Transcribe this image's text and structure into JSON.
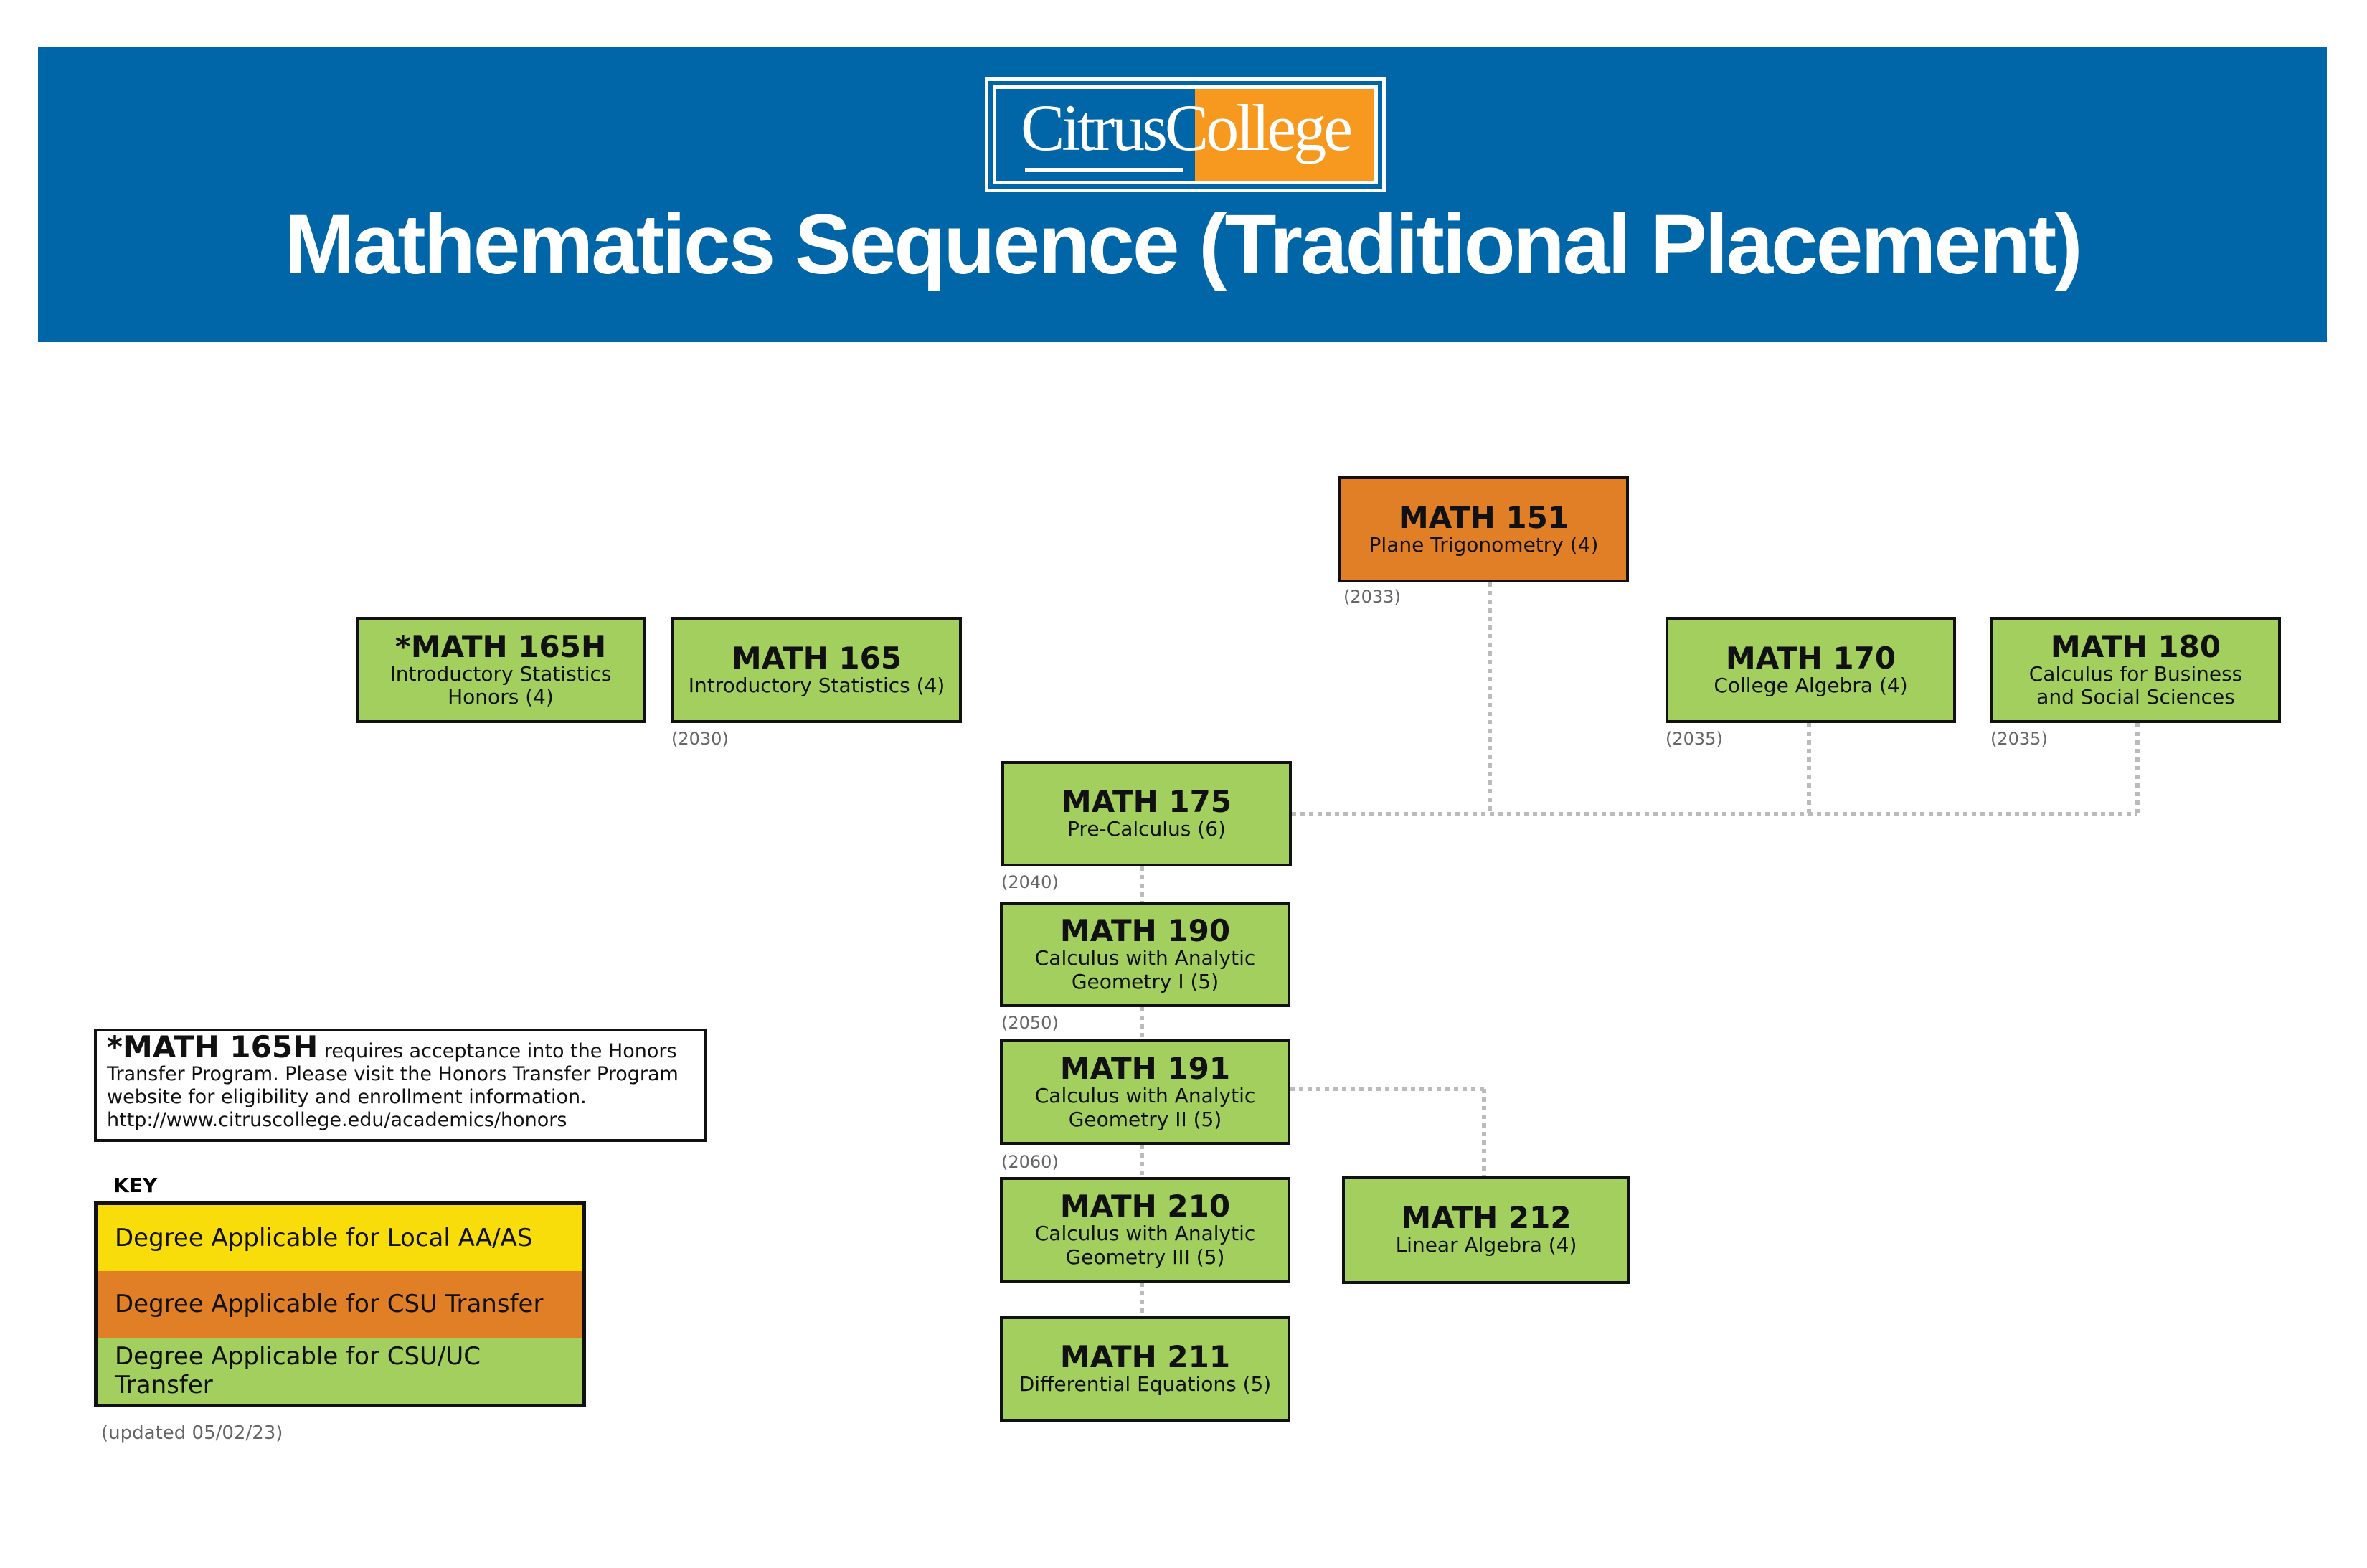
{
  "header": {
    "logo_text_left": "Citrus",
    "logo_text_right": "College",
    "title": "Mathematics Sequence (Traditional Placement)"
  },
  "colors": {
    "header_blue": "#0066a8",
    "logo_orange": "#f7991f",
    "local_aa_as": "#f9dd0a",
    "csu_transfer": "#e07f26",
    "csu_uc_transfer": "#a3cf5f",
    "connector": "#bbbbbb"
  },
  "courses": {
    "m151": {
      "code": "MATH 151",
      "name": "Plane Trigonometry (4)",
      "number": "(2033)",
      "category": "csu_transfer"
    },
    "m165h": {
      "code": "*MATH 165H",
      "name": "Introductory Statistics Honors (4)",
      "category": "csu_uc_transfer"
    },
    "m165": {
      "code": "MATH 165",
      "name": "Introductory Statistics (4)",
      "number": "(2030)",
      "category": "csu_uc_transfer"
    },
    "m170": {
      "code": "MATH 170",
      "name": "College Algebra (4)",
      "number": "(2035)",
      "category": "csu_uc_transfer"
    },
    "m180": {
      "code": "MATH 180",
      "name": "Calculus for Business and Social Sciences",
      "number": "(2035)",
      "category": "csu_uc_transfer"
    },
    "m175": {
      "code": "MATH 175",
      "name": "Pre-Calculus (6)",
      "number": "(2040)",
      "category": "csu_uc_transfer"
    },
    "m190": {
      "code": "MATH 190",
      "name": "Calculus with Analytic Geometry I (5)",
      "number": "(2050)",
      "category": "csu_uc_transfer"
    },
    "m191": {
      "code": "MATH 191",
      "name": "Calculus with Analytic Geometry II (5)",
      "number": "(2060)",
      "category": "csu_uc_transfer"
    },
    "m210": {
      "code": "MATH 210",
      "name": "Calculus with Analytic Geometry III (5)",
      "category": "csu_uc_transfer"
    },
    "m212": {
      "code": "MATH 212",
      "name": "Linear Algebra (4)",
      "category": "csu_uc_transfer"
    },
    "m211": {
      "code": "MATH 211",
      "name": "Differential Equations (5)",
      "category": "csu_uc_transfer"
    }
  },
  "connections": [
    [
      "MATH 151",
      "MATH 175"
    ],
    [
      "MATH 170",
      "MATH 175"
    ],
    [
      "MATH 180",
      "MATH 175"
    ],
    [
      "MATH 175",
      "MATH 190"
    ],
    [
      "MATH 190",
      "MATH 191"
    ],
    [
      "MATH 191",
      "MATH 210"
    ],
    [
      "MATH 191",
      "MATH 212"
    ],
    [
      "MATH 210",
      "MATH 211"
    ]
  ],
  "note": {
    "bold": "*MATH 165H",
    "text": " requires acceptance into the Honors Transfer Program. Please visit the Honors Transfer Program website for eligibility and enrollment information.",
    "url": "http://www.citruscollege.edu/academics/honors"
  },
  "key": {
    "label": "KEY",
    "items": [
      {
        "label": "Degree Applicable for Local AA/AS",
        "color": "#f9dd0a"
      },
      {
        "label": "Degree Applicable for CSU Transfer",
        "color": "#e07f26"
      },
      {
        "label": "Degree Applicable for CSU/UC Transfer",
        "color": "#a3cf5f"
      }
    ]
  },
  "updated": "(updated 05/02/23)"
}
